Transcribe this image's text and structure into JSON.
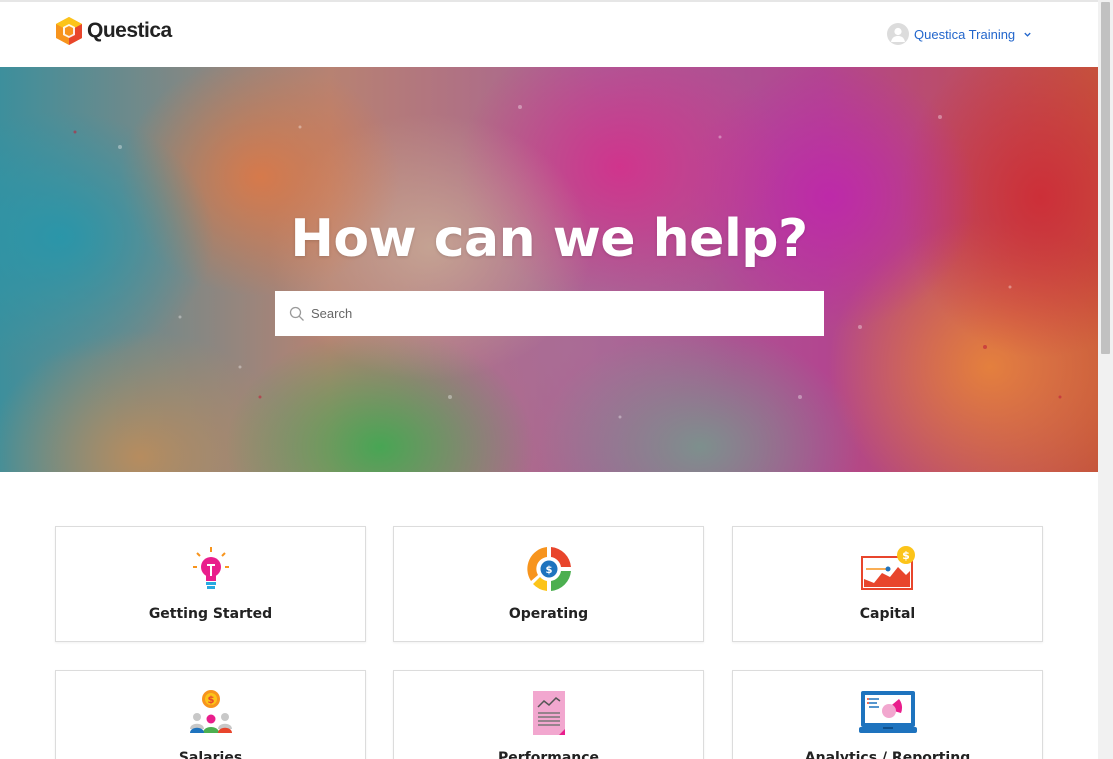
{
  "header": {
    "logo_text": "Questica",
    "user_name": "Questica Training",
    "user_menu_icon": "chevron-down-icon"
  },
  "hero": {
    "title": "How can we help?",
    "search_placeholder": "Search"
  },
  "categories": [
    {
      "label": "Getting Started",
      "icon": "lightbulb-icon"
    },
    {
      "label": "Operating",
      "icon": "donut-dollar-icon"
    },
    {
      "label": "Capital",
      "icon": "capital-chart-icon"
    },
    {
      "label": "Salaries",
      "icon": "people-dollar-icon"
    },
    {
      "label": "Performance",
      "icon": "performance-report-icon"
    },
    {
      "label": "Analytics / Reporting",
      "icon": "analytics-monitor-icon"
    }
  ],
  "colors": {
    "link": "#2266cc",
    "logo_orange": "#f7941d",
    "logo_red": "#e8452c",
    "logo_yellow": "#fcc419"
  }
}
